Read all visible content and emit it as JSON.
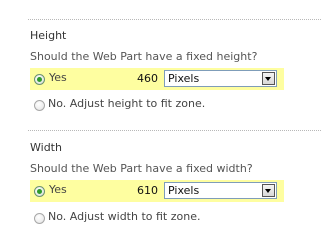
{
  "height": {
    "title": "Height",
    "question": "Should the Web Part have a fixed height?",
    "yes_label": "Yes",
    "value": "460",
    "unit": "Pixels",
    "no_label": "No. Adjust height to fit zone.",
    "yes_selected": true
  },
  "width": {
    "title": "Width",
    "question": "Should the Web Part have a fixed width?",
    "yes_label": "Yes",
    "value": "610",
    "unit": "Pixels",
    "no_label": "No. Adjust width to fit zone.",
    "yes_selected": true
  },
  "colors": {
    "highlight": "#fefea0",
    "radio_checked": "#2f9a2a",
    "select_border": "#7f9db9",
    "divider": "#b8b8b8"
  }
}
